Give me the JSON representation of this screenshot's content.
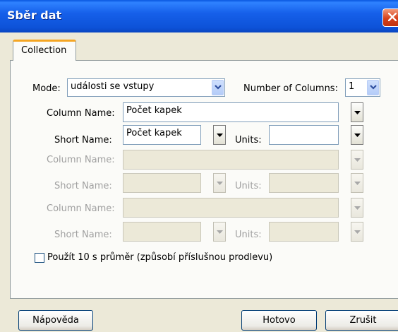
{
  "window": {
    "title": "Sběr dat"
  },
  "tabs": [
    {
      "label": "Collection"
    }
  ],
  "mode": {
    "label": "Mode:",
    "value": "události se vstupy"
  },
  "columns_count": {
    "label": "Number of Columns:",
    "value": "1"
  },
  "rows": [
    {
      "column_name_label": "Column Name:",
      "column_name_value": "Počet kapek",
      "short_name_label": "Short Name:",
      "short_name_value": "Počet kapek",
      "units_label": "Units:",
      "units_value": "",
      "enabled": true
    },
    {
      "column_name_label": "Column Name:",
      "column_name_value": "",
      "short_name_label": "Short Name:",
      "short_name_value": "",
      "units_label": "Units:",
      "units_value": "",
      "enabled": false
    },
    {
      "column_name_label": "Column Name:",
      "column_name_value": "",
      "short_name_label": "Short Name:",
      "short_name_value": "",
      "units_label": "Units:",
      "units_value": "",
      "enabled": false
    }
  ],
  "average_checkbox": {
    "label": "Použít 10 s průměr (způsobí příslušnou prodlevu)",
    "checked": false
  },
  "buttons": {
    "help": "Nápověda",
    "done": "Hotovo",
    "cancel": "Zrušit"
  },
  "colors": {
    "titlebar": "#0d52d8",
    "tab_highlight": "#f5a623",
    "dialog_bg": "#ece9d8",
    "disabled_text": "#a0a0a0"
  },
  "icons": {
    "close": "close-icon",
    "dropdown": "chevron-down-icon"
  }
}
